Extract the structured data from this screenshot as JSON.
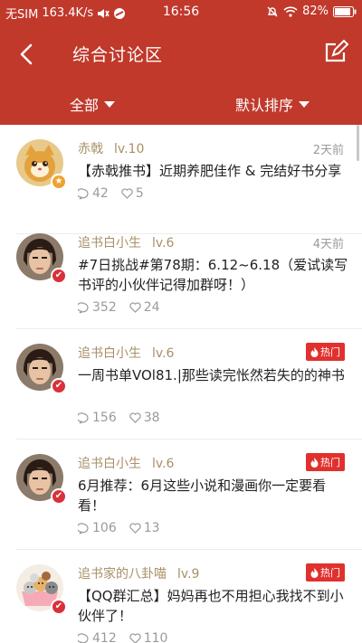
{
  "status_bar": {
    "carrier": "无SIM",
    "net_speed": "163.4K/s",
    "time": "16:56",
    "battery": "82%"
  },
  "nav": {
    "title": "综合讨论区"
  },
  "filters": {
    "all_label": "全部",
    "sort_label": "默认排序"
  },
  "posts": [
    {
      "author": "赤戟",
      "level": "lv.10",
      "time": "2天前",
      "hot": "",
      "title": "【赤戟推书】近期养肥佳作 & 完结好书分享",
      "comments": "42",
      "likes": "5",
      "badge": "star"
    },
    {
      "author": "追书白小生",
      "level": "lv.6",
      "time": "4天前",
      "hot": "",
      "title": "#7日挑战#第78期：6.12~6.18（爱试读写书评的小伙伴记得加群呀！）",
      "comments": "352",
      "likes": "24",
      "badge": "v"
    },
    {
      "author": "追书白小生",
      "level": "lv.6",
      "time": "",
      "hot": "热门",
      "title": "一周书单VOl81.|那些读完怅然若失的的神书",
      "comments": "156",
      "likes": "38",
      "badge": "v"
    },
    {
      "author": "追书白小生",
      "level": "lv.6",
      "time": "",
      "hot": "热门",
      "title": "6月推荐：6月这些小说和漫画你一定要看看！",
      "comments": "106",
      "likes": "13",
      "badge": "v"
    },
    {
      "author": "追书家的八卦喵",
      "level": "lv.9",
      "time": "",
      "hot": "热门",
      "title": "【QQ群汇总】妈妈再也不用担心我找不到小伙伴了！",
      "comments": "412",
      "likes": "110",
      "badge": "v"
    }
  ],
  "colors": {
    "header_bg": "#c0392b",
    "author": "#a89067",
    "hot_badge": "#e0312e",
    "verified_badge": "#d8313a",
    "star_badge": "#f0a22e"
  },
  "icons": {
    "back": "back-arrow-icon",
    "compose": "compose-icon",
    "comment": "comment-icon",
    "like": "heart-icon",
    "hot": "flame-icon"
  }
}
